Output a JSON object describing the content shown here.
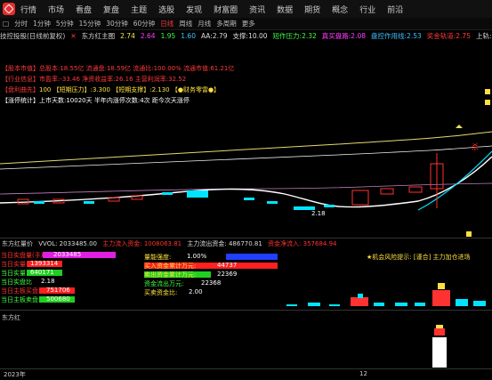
{
  "menu": [
    "行情",
    "市场",
    "看盘",
    "复盘",
    "主题",
    "选股",
    "发现",
    "财富圈",
    "资讯",
    "数据",
    "期货",
    "概念",
    "行业",
    "前沿"
  ],
  "periods": {
    "icon": "□",
    "items": [
      "分时",
      "1分钟",
      "5分钟",
      "15分钟",
      "30分钟",
      "60分钟",
      "日线",
      "周线",
      "月线",
      "多周期",
      "更多"
    ],
    "selected": "日线"
  },
  "infobar": {
    "title": "技控投股(日线前复权)",
    "stock": "东方红主图",
    "v1": "2.74",
    "v2": "2.64",
    "v3": "1.95",
    "v4": "1.60",
    "aa": "AA:2.79",
    "support": "支撑:10.00",
    "short_pressure": "短作压力:2.32",
    "real_turn": "真买盘路:2.08",
    "box_top": "盘控作用线:2.53",
    "bull_track": "奖金轨道:2.75",
    "upper": "上轨:"
  },
  "info_lines": [
    {
      "label": "【股本市值】",
      "text": "总股本:18.55亿 流通盘:18.59亿 流通比:100.00% 流通市值:61.21亿"
    },
    {
      "label": "【行业信息】",
      "text": "市盈率:-33.46 净资收益率:26.16 主营利润率:32.52"
    },
    {
      "label": "【盘利曲先】",
      "text": "100 【短期压力】:3.300 【短期支撑】:2.130 【●财务零雷●】"
    },
    {
      "label": "【涨停统计】",
      "text": "上市天数:10020天 半年内涨停次数:4次  距今次天涨停"
    }
  ],
  "main_chart": {
    "low_label": "2.18",
    "annot": "杀"
  },
  "sub1": {
    "title": "东方红量价",
    "vvol": "VVOL: 2033485.00",
    "main_inflow": "主力流入资金: 1008063.81",
    "main_outflow": "主力流出资金: 486770.81",
    "net": "资金净流入: 357684.94",
    "alert": "★机会风险提示: [谨合] 主力加仓进场",
    "rows_left": [
      {
        "label": "当日实盘量(手)",
        "value": "2033485",
        "bar": "#e020e0"
      },
      {
        "label": "当日实量",
        "value": "1393314",
        "bar": "#ff2020"
      },
      {
        "label": "当日实量",
        "value": "640171",
        "bar": "#20d020"
      },
      {
        "label": "当日实盘比",
        "value": "2.18",
        "bar": ""
      },
      {
        "label": "当日主板买盘",
        "value": "751706",
        "bar": "#ff2020"
      },
      {
        "label": "当日主板卖盘",
        "value": "500680",
        "bar": "#20d020"
      }
    ],
    "rows_mid": [
      {
        "label": "量能强度:",
        "value": "1.00%",
        "bar": "#2040ff"
      },
      {
        "label": "买入资金累计万元:",
        "value": "44737",
        "bar": "#ff2020"
      },
      {
        "label": "卖出资金累计万元:",
        "value": "22369",
        "bar": "#20d020"
      },
      {
        "label": "资金流出万元:",
        "value": "22368",
        "bar": ""
      },
      {
        "label": "买卖资金比:",
        "value": "2.00",
        "bar": ""
      }
    ]
  },
  "sub2": {
    "title": "东方红"
  },
  "timeaxis": {
    "left": "2023年",
    "mid": "12"
  },
  "colors": {
    "up": "#ff3232",
    "down": "#00e5ff",
    "ma1": "#ffffff",
    "ma2": "#f0e060",
    "ma3": "#e0a0ff"
  }
}
